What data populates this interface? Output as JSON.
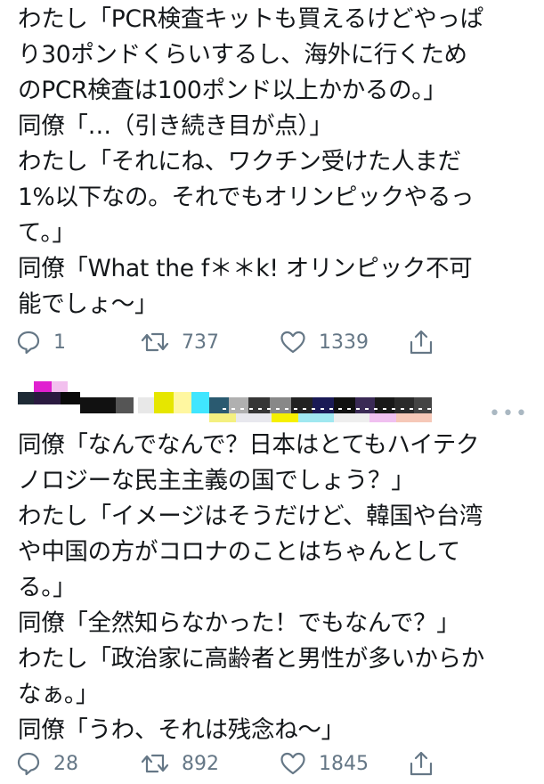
{
  "tweet1": {
    "lines": [
      "わたし「PCR検査キットも買えるけどやっぱ",
      "り30ポンドくらいするし、海外に行くため",
      "のPCR検査は100ポンド以上かかるの。」",
      "同僚「…（引き続き目が点）」",
      "わたし「それにね、ワクチン受けた人まだ",
      "1%以下なの。それでもオリンピックやるっ",
      "て。」",
      "同僚「What the f＊＊k! オリンピック不可",
      "能でしょ〜」"
    ],
    "actions": {
      "replies": "1",
      "retweets": "737",
      "likes": "1339"
    }
  },
  "tweet2": {
    "lines": [
      "同僚「なんでなんで？日本はとてもハイテク",
      "ノロジーな民主主義の国でしょう？」",
      "わたし「イメージはそうだけど、韓国や台湾",
      "や中国の方がコロナのことはちゃんとして",
      "る。」",
      "同僚「全然知らなかった！でもなんで？」",
      "わたし「政治家に高齢者と男性が多いからか",
      "なぁ。」",
      "同僚「うわ、それは残念ね〜」"
    ],
    "actions": {
      "replies": "28",
      "retweets": "892",
      "likes": "1845"
    }
  },
  "icons": {
    "reply": "reply-icon",
    "retweet": "retweet-icon",
    "like": "heart-icon",
    "share": "share-icon",
    "more": "more-icon"
  },
  "colors": {
    "text": "#14171a",
    "icon": "#657786"
  }
}
